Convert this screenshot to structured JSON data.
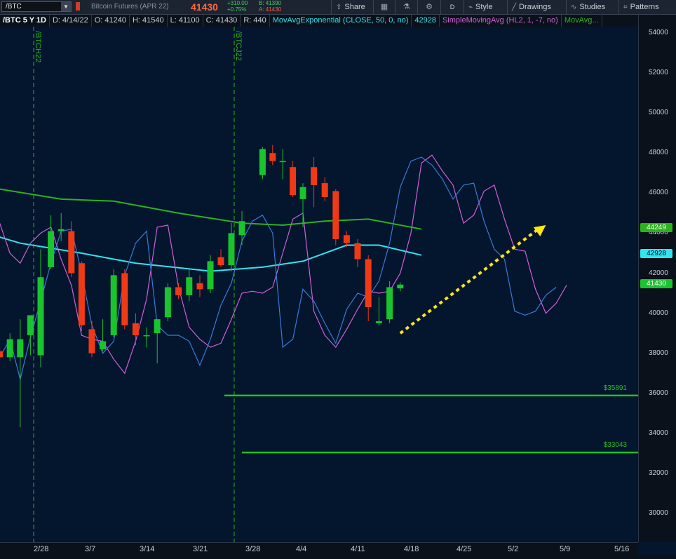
{
  "toolbar": {
    "symbol": "/BTC",
    "instrument": "Bitcoin Futures (APR 22)",
    "last": "41430",
    "change_abs": "+310.00",
    "change_pct": "+0.75%",
    "bid": "B: 41390",
    "ask": "A: 41430",
    "share": "Share",
    "period": "D",
    "style": "Style",
    "drawings": "Drawings",
    "studies": "Studies",
    "patterns": "Patterns"
  },
  "infobar": {
    "period": "/BTC 5 Y 1D",
    "date": "D: 4/14/22",
    "open": "O: 41240",
    "high": "H: 41540",
    "low": "L: 41100",
    "close": "C: 41430",
    "range": "R: 440",
    "ema_label": "MovAvgExponential (CLOSE, 50, 0, no)",
    "ema_value": "42928",
    "sma_label": "SimpleMovingAvg (HL2, 1, -7, no)",
    "ma3_label": "MovAvg..."
  },
  "colors": {
    "up": "#19c42c",
    "down": "#f03a16",
    "ema": "#2fe6f0",
    "sma": "#d060d8",
    "movavg": "#2bb31c",
    "shifted": "#3a7bd8",
    "arrow": "#ffe617",
    "support": "#1ec21e"
  },
  "chart_data": {
    "type": "candlestick",
    "symbol": "/BTC",
    "ylim": [
      28500,
      55000
    ],
    "y_ticks": [
      54000,
      52000,
      50000,
      48000,
      46000,
      44000,
      42000,
      40000,
      38000,
      36000,
      34000,
      32000,
      30000
    ],
    "x_ticks": [
      "2/28",
      "3/7",
      "3/14",
      "3/21",
      "3/28",
      "4/4",
      "4/11",
      "4/18",
      "4/25",
      "5/2",
      "5/9",
      "5/16"
    ],
    "contract_roll_labels": [
      "/BTCH22",
      "/BTCJ22"
    ],
    "candles": [
      {
        "date": "2/22",
        "o": 38100,
        "h": 38300,
        "l": 37700,
        "c": 37800
      },
      {
        "date": "2/23",
        "o": 37800,
        "h": 39000,
        "l": 37600,
        "c": 38700
      },
      {
        "date": "2/24",
        "o": 37800,
        "h": 39700,
        "l": 34300,
        "c": 38700
      },
      {
        "date": "2/25",
        "o": 38900,
        "h": 39200,
        "l": 37900,
        "c": 39900
      },
      {
        "date": "2/28",
        "o": 37900,
        "h": 43200,
        "l": 37300,
        "c": 41800
      },
      {
        "date": "3/1",
        "o": 42300,
        "h": 44900,
        "l": 42200,
        "c": 44100
      },
      {
        "date": "3/2",
        "o": 44100,
        "h": 45000,
        "l": 43600,
        "c": 44200
      },
      {
        "date": "3/3",
        "o": 44100,
        "h": 44600,
        "l": 41800,
        "c": 42000
      },
      {
        "date": "3/4",
        "o": 42500,
        "h": 42600,
        "l": 39100,
        "c": 39400
      },
      {
        "date": "3/7",
        "o": 39200,
        "h": 39600,
        "l": 37800,
        "c": 38000
      },
      {
        "date": "3/8",
        "o": 38200,
        "h": 39700,
        "l": 38100,
        "c": 38600
      },
      {
        "date": "3/9",
        "o": 38900,
        "h": 42200,
        "l": 38800,
        "c": 41900
      },
      {
        "date": "3/10",
        "o": 42000,
        "h": 42200,
        "l": 39200,
        "c": 39400
      },
      {
        "date": "3/11",
        "o": 39500,
        "h": 40000,
        "l": 38400,
        "c": 38900
      },
      {
        "date": "3/14",
        "o": 38900,
        "h": 39300,
        "l": 38300,
        "c": 38900
      },
      {
        "date": "3/15",
        "o": 39000,
        "h": 39400,
        "l": 37500,
        "c": 39700
      },
      {
        "date": "3/16",
        "o": 39800,
        "h": 41500,
        "l": 39600,
        "c": 41300
      },
      {
        "date": "3/17",
        "o": 41300,
        "h": 41500,
        "l": 40700,
        "c": 40900
      },
      {
        "date": "3/18",
        "o": 40900,
        "h": 42200,
        "l": 40600,
        "c": 41800
      },
      {
        "date": "3/21",
        "o": 41500,
        "h": 41900,
        "l": 40800,
        "c": 41200
      },
      {
        "date": "3/22",
        "o": 41200,
        "h": 42900,
        "l": 41000,
        "c": 42600
      },
      {
        "date": "3/23",
        "o": 42800,
        "h": 43200,
        "l": 42300,
        "c": 42400
      },
      {
        "date": "3/24",
        "o": 42400,
        "h": 44500,
        "l": 42100,
        "c": 44000
      },
      {
        "date": "3/25",
        "o": 43900,
        "h": 45100,
        "l": 43400,
        "c": 44600
      },
      {
        "date": "3/28",
        "o": 46900,
        "h": 48300,
        "l": 46700,
        "c": 48200
      },
      {
        "date": "3/29",
        "o": 48000,
        "h": 48400,
        "l": 47400,
        "c": 47600
      },
      {
        "date": "3/30",
        "o": 47600,
        "h": 48200,
        "l": 46700,
        "c": 47600
      },
      {
        "date": "3/31",
        "o": 47300,
        "h": 47600,
        "l": 45800,
        "c": 45900
      },
      {
        "date": "4/1",
        "o": 45700,
        "h": 46500,
        "l": 44300,
        "c": 46300
      },
      {
        "date": "4/4",
        "o": 47300,
        "h": 47800,
        "l": 45300,
        "c": 46400
      },
      {
        "date": "4/5",
        "o": 46500,
        "h": 46800,
        "l": 45600,
        "c": 45800
      },
      {
        "date": "4/6",
        "o": 46100,
        "h": 46200,
        "l": 43400,
        "c": 43700
      },
      {
        "date": "4/7",
        "o": 43900,
        "h": 44100,
        "l": 43300,
        "c": 43500
      },
      {
        "date": "4/8",
        "o": 43500,
        "h": 43700,
        "l": 42300,
        "c": 42700
      },
      {
        "date": "4/11",
        "o": 42700,
        "h": 42900,
        "l": 39600,
        "c": 40300
      },
      {
        "date": "4/12",
        "o": 39500,
        "h": 40800,
        "l": 39400,
        "c": 39600
      },
      {
        "date": "4/13",
        "o": 39700,
        "h": 41600,
        "l": 39500,
        "c": 41300
      },
      {
        "date": "4/14",
        "o": 41240,
        "h": 41540,
        "l": 41100,
        "c": 41430
      }
    ],
    "series": [
      {
        "name": "MovAvgExponential (CLOSE, 50, 0, no)",
        "color": "#2fe6f0",
        "points": [
          [
            -2,
            43800
          ],
          [
            0,
            43500
          ],
          [
            6,
            43000
          ],
          [
            11,
            42500
          ],
          [
            18,
            42100
          ],
          [
            23,
            42300
          ],
          [
            27,
            42600
          ],
          [
            31,
            43400
          ],
          [
            34,
            43400
          ],
          [
            38,
            42900
          ]
        ]
      },
      {
        "name": "MovAvg",
        "color": "#2bb31c",
        "points": [
          [
            -2,
            46200
          ],
          [
            4,
            45700
          ],
          [
            9,
            45600
          ],
          [
            15,
            45000
          ],
          [
            21,
            44500
          ],
          [
            25,
            44400
          ],
          [
            29,
            44600
          ],
          [
            33,
            44700
          ],
          [
            38,
            44200
          ]
        ]
      },
      {
        "name": "SimpleMovingAvg (HL2, 1, -7, no)",
        "color": "#d060d8",
        "points": [
          [
            -2,
            44500
          ],
          [
            -1,
            43000
          ],
          [
            0,
            42500
          ],
          [
            1,
            43500
          ],
          [
            2,
            44000
          ],
          [
            3,
            44300
          ],
          [
            4,
            42700
          ],
          [
            5,
            41400
          ],
          [
            6,
            38900
          ],
          [
            7,
            38700
          ],
          [
            8,
            38600
          ],
          [
            9,
            37700
          ],
          [
            10,
            37000
          ],
          [
            11,
            38600
          ],
          [
            12,
            40700
          ],
          [
            13,
            44300
          ],
          [
            14,
            44400
          ],
          [
            15,
            41300
          ],
          [
            16,
            39300
          ],
          [
            17,
            38700
          ],
          [
            18,
            38300
          ],
          [
            19,
            38500
          ],
          [
            20,
            39700
          ],
          [
            21,
            41000
          ],
          [
            22,
            41100
          ],
          [
            23,
            41000
          ],
          [
            24,
            41300
          ],
          [
            25,
            43000
          ],
          [
            26,
            44700
          ],
          [
            27,
            45000
          ],
          [
            28,
            40100
          ],
          [
            29,
            38900
          ],
          [
            30,
            38300
          ],
          [
            31,
            39200
          ],
          [
            32,
            40200
          ],
          [
            33,
            41100
          ],
          [
            34,
            41000
          ],
          [
            35,
            41100
          ],
          [
            36,
            42000
          ],
          [
            37,
            44000
          ],
          [
            38,
            47500
          ],
          [
            39,
            47900
          ],
          [
            40,
            47100
          ],
          [
            41,
            46400
          ],
          [
            42,
            44500
          ],
          [
            43,
            44900
          ],
          [
            44,
            46100
          ],
          [
            45,
            46400
          ],
          [
            46,
            44700
          ],
          [
            47,
            43200
          ],
          [
            48,
            43100
          ],
          [
            49,
            41200
          ],
          [
            50,
            40000
          ],
          [
            51,
            40500
          ],
          [
            52,
            41400
          ]
        ]
      },
      {
        "name": "Close (shifted)",
        "color": "#3a7bd8",
        "points": [
          [
            -2,
            37800
          ],
          [
            -1,
            38700
          ],
          [
            0,
            36700
          ],
          [
            1,
            38800
          ],
          [
            2,
            40600
          ],
          [
            3,
            42500
          ],
          [
            4,
            44100
          ],
          [
            5,
            44200
          ],
          [
            6,
            42000
          ],
          [
            7,
            39400
          ],
          [
            8,
            38000
          ],
          [
            9,
            38600
          ],
          [
            10,
            41900
          ],
          [
            11,
            43500
          ],
          [
            12,
            44100
          ],
          [
            13,
            39400
          ],
          [
            14,
            38900
          ],
          [
            15,
            38900
          ],
          [
            16,
            38600
          ],
          [
            17,
            37400
          ],
          [
            18,
            38700
          ],
          [
            19,
            40400
          ],
          [
            20,
            41500
          ],
          [
            21,
            43600
          ],
          [
            22,
            44600
          ],
          [
            23,
            44900
          ],
          [
            24,
            44000
          ],
          [
            25,
            38300
          ],
          [
            26,
            38700
          ],
          [
            27,
            41200
          ],
          [
            28,
            40600
          ],
          [
            29,
            39500
          ],
          [
            30,
            38500
          ],
          [
            31,
            40200
          ],
          [
            32,
            41000
          ],
          [
            33,
            40800
          ],
          [
            34,
            41600
          ],
          [
            35,
            43500
          ],
          [
            36,
            46300
          ],
          [
            37,
            47600
          ],
          [
            38,
            47800
          ],
          [
            39,
            47400
          ],
          [
            40,
            46700
          ],
          [
            41,
            45700
          ],
          [
            42,
            46400
          ],
          [
            43,
            46500
          ],
          [
            44,
            44600
          ],
          [
            45,
            43200
          ],
          [
            46,
            42700
          ],
          [
            47,
            40100
          ],
          [
            48,
            39900
          ],
          [
            49,
            40100
          ],
          [
            50,
            40900
          ],
          [
            51,
            41300
          ]
        ]
      }
    ],
    "annotations": [
      {
        "type": "arrow",
        "label": "",
        "from": [
          38,
          39000
        ],
        "to": [
          52,
          44400
        ]
      },
      {
        "type": "hline",
        "label": "$35891",
        "value": 35891
      },
      {
        "type": "hline",
        "label": "$33043",
        "value": 33043
      }
    ],
    "price_badges": [
      {
        "value": "44249",
        "color": "#2bb31c"
      },
      {
        "value": "42928",
        "color": "#2fe6f0"
      },
      {
        "value": "41430",
        "color": "#19c42c"
      }
    ]
  }
}
